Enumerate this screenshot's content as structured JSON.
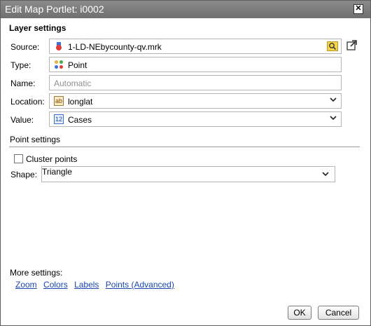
{
  "window": {
    "title": "Edit Map Portlet: i0002",
    "close_label": "✕"
  },
  "layer": {
    "heading": "Layer settings",
    "source": {
      "label": "Source:",
      "value": "1-LD-NEbycounty-qv.mrk"
    },
    "type": {
      "label": "Type:",
      "value": "Point"
    },
    "name": {
      "label": "Name:",
      "placeholder": "Automatic"
    },
    "location": {
      "label": "Location:",
      "value": "longlat",
      "icon_text": "ab"
    },
    "value": {
      "label": "Value:",
      "value": "Cases",
      "icon_text": "12"
    }
  },
  "point": {
    "heading": "Point settings",
    "cluster_label": "Cluster points",
    "cluster_checked": false,
    "shape_label": "Shape:",
    "shape_value": "Triangle"
  },
  "more": {
    "heading": "More settings:",
    "links": [
      "Zoom",
      "Colors",
      "Labels",
      "Points (Advanced)"
    ]
  },
  "buttons": {
    "ok": "OK",
    "cancel": "Cancel"
  },
  "colors": {
    "title_bar": "#7b7b7b",
    "link": "#1b46b0"
  }
}
